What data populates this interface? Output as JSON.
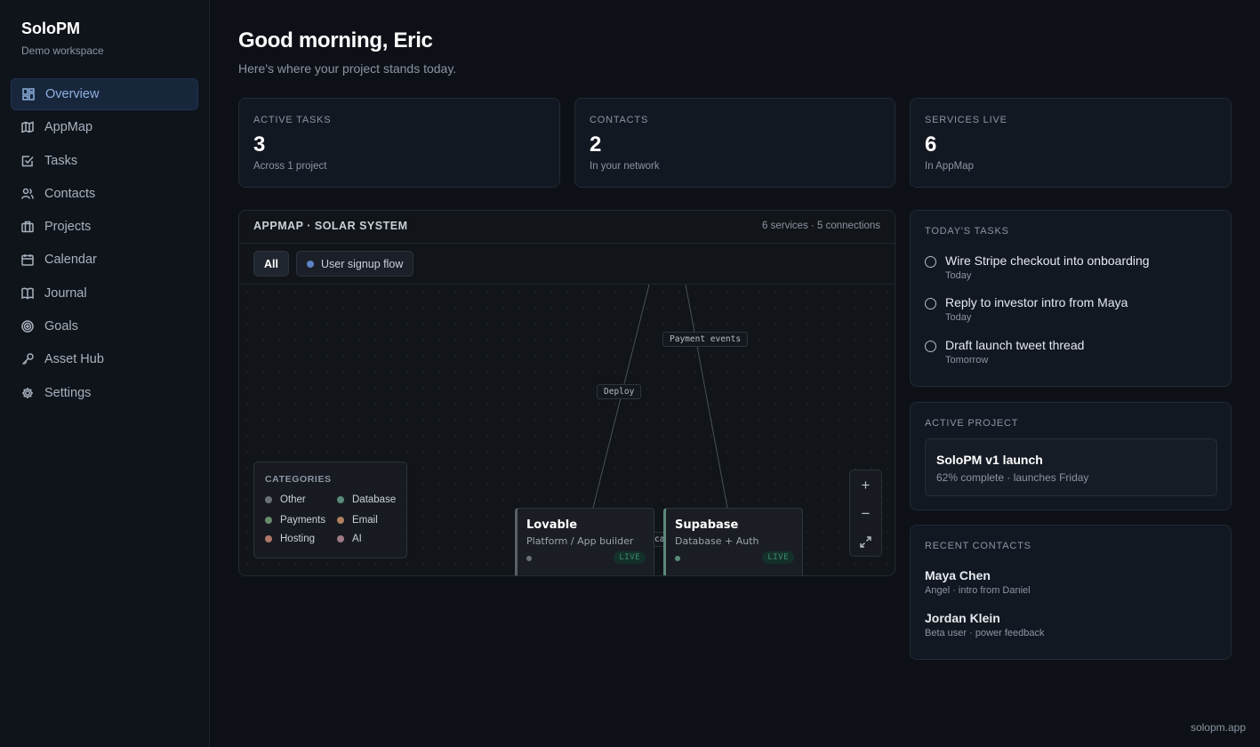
{
  "sidebar": {
    "brand": "SoloPM",
    "workspace": "Demo workspace",
    "items": [
      {
        "label": "Overview",
        "icon": "dashboard-icon"
      },
      {
        "label": "AppMap",
        "icon": "map-icon"
      },
      {
        "label": "Tasks",
        "icon": "checkbox-icon"
      },
      {
        "label": "Contacts",
        "icon": "users-icon"
      },
      {
        "label": "Projects",
        "icon": "briefcase-icon"
      },
      {
        "label": "Calendar",
        "icon": "calendar-icon"
      },
      {
        "label": "Journal",
        "icon": "book-icon"
      },
      {
        "label": "Goals",
        "icon": "target-icon"
      },
      {
        "label": "Asset Hub",
        "icon": "key-icon"
      },
      {
        "label": "Settings",
        "icon": "gear-icon"
      }
    ],
    "active": "Overview"
  },
  "header": {
    "greeting": "Good morning, Eric",
    "subtitle": "Here's where your project stands today."
  },
  "stats": [
    {
      "label": "ACTIVE TASKS",
      "value": "3",
      "note": "Across 1 project"
    },
    {
      "label": "CONTACTS",
      "value": "2",
      "note": "In your network"
    },
    {
      "label": "SERVICES LIVE",
      "value": "6",
      "note": "In AppMap"
    }
  ],
  "appmap": {
    "title": "APPMAP · SOLAR SYSTEM",
    "meta": "6 services · 5 connections",
    "filters": {
      "all": "All",
      "flow": "User signup flow"
    },
    "edge_labels": {
      "payment": "Payment events",
      "deploy": "Deploy",
      "partial": "ca"
    },
    "legend": {
      "title": "CATEGORIES",
      "items": [
        {
          "label": "Other",
          "color": "#6a6f77"
        },
        {
          "label": "Database",
          "color": "#5b8a7a"
        },
        {
          "label": "Payments",
          "color": "#6a8a6f"
        },
        {
          "label": "Email",
          "color": "#b07f5f"
        },
        {
          "label": "Hosting",
          "color": "#b0766a"
        },
        {
          "label": "AI",
          "color": "#a07a86"
        }
      ]
    },
    "nodes": [
      {
        "name": "Lovable",
        "desc": "Platform / App builder",
        "status": "LIVE"
      },
      {
        "name": "Supabase",
        "desc": "Database + Auth",
        "status": "LIVE"
      }
    ],
    "zoom": {
      "in": "+",
      "out": "−",
      "fit": "fullscreen-icon"
    }
  },
  "today": {
    "title": "TODAY'S TASKS",
    "tasks": [
      {
        "title": "Wire Stripe checkout into onboarding",
        "when": "Today"
      },
      {
        "title": "Reply to investor intro from Maya",
        "when": "Today"
      },
      {
        "title": "Draft launch tweet thread",
        "when": "Tomorrow"
      }
    ]
  },
  "project": {
    "title": "ACTIVE PROJECT",
    "name": "SoloPM v1 launch",
    "status": "62% complete · launches Friday"
  },
  "contacts": {
    "title": "RECENT CONTACTS",
    "items": [
      {
        "name": "Maya Chen",
        "note": "Angel · intro from Daniel"
      },
      {
        "name": "Jordan Klein",
        "note": "Beta user · power feedback"
      }
    ]
  },
  "footer": "solopm.app"
}
